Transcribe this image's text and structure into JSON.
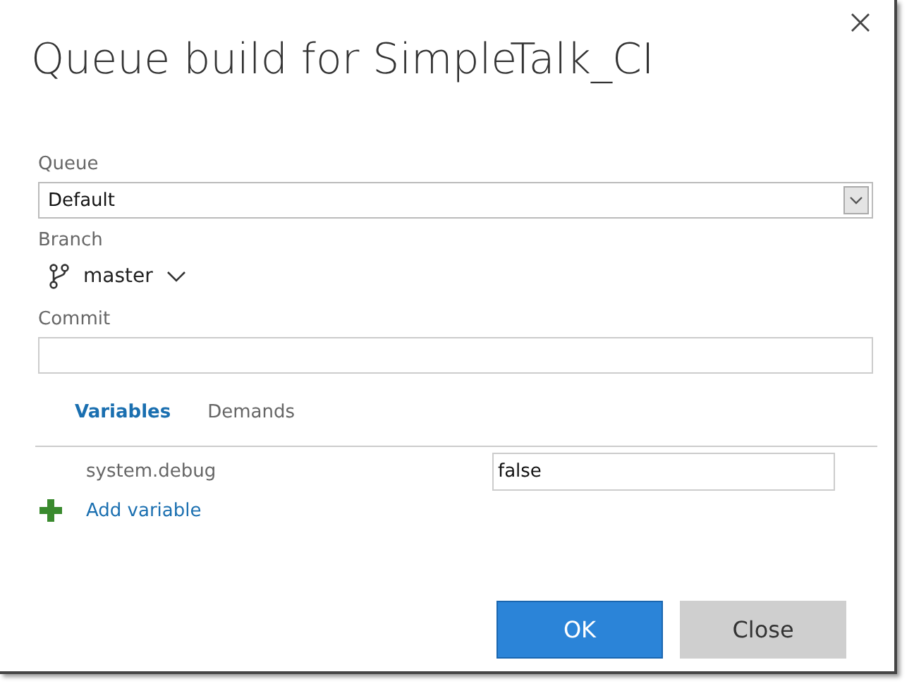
{
  "dialog": {
    "title": "Queue build for SimpleTalk_CI"
  },
  "queue": {
    "label": "Queue",
    "value": "Default"
  },
  "branch": {
    "label": "Branch",
    "value": "master"
  },
  "commit": {
    "label": "Commit"
  },
  "tabs": [
    {
      "label": "Variables",
      "selected": true
    },
    {
      "label": "Demands",
      "selected": false
    }
  ],
  "variables": [
    {
      "name": "system.debug",
      "value": "false"
    }
  ],
  "add_variable": "Add variable",
  "buttons": [
    {
      "label": "OK",
      "kind": "primary"
    },
    {
      "label": "Close",
      "kind": "secondary"
    }
  ]
}
